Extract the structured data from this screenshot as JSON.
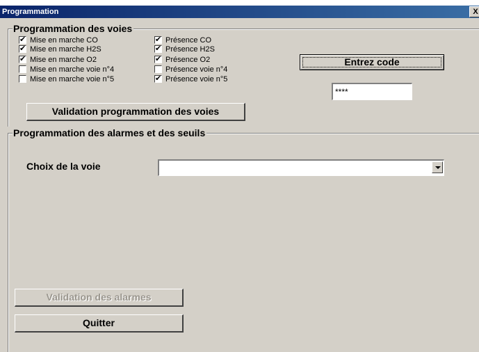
{
  "window": {
    "title": "Programmation",
    "close_label": "X"
  },
  "voies": {
    "group_title": "Programmation des voies",
    "mise_en_marche": [
      {
        "label": "Mise en marche CO",
        "checked": true
      },
      {
        "label": "Mise en marche H2S",
        "checked": true
      },
      {
        "label": "Mise en marche O2",
        "checked": true
      },
      {
        "label": "Mise en marche voie n°4",
        "checked": false
      },
      {
        "label": "Mise en marche voie n°5",
        "checked": false
      }
    ],
    "presence": [
      {
        "label": "Présence CO",
        "checked": true
      },
      {
        "label": "Présence H2S",
        "checked": true
      },
      {
        "label": "Présence O2",
        "checked": true
      },
      {
        "label": "Présence voie n°4",
        "checked": false
      },
      {
        "label": "Présence voie n°5",
        "checked": true
      }
    ],
    "validate_button": "Validation programmation des voies",
    "code_button": "Entrez code",
    "code_value": "****"
  },
  "alarmes": {
    "group_title": "Programmation des alarmes et des seuils",
    "choix_label": "Choix de la voie",
    "choix_value": "",
    "validate_button": "Validation des alarmes",
    "quit_button": "Quitter"
  }
}
